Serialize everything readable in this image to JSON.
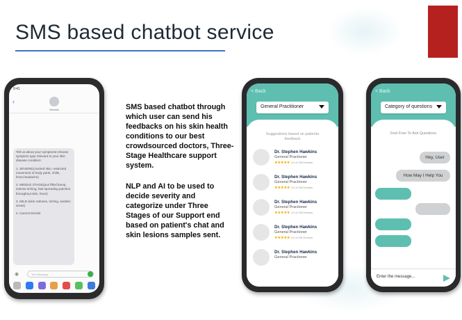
{
  "slide": {
    "title": "SMS based chatbot service",
    "paragraph1": "SMS based chatbot through which user can send his feedbacks on his skin health conditions to our best crowdsourced doctors, Three-Stage Healthcare support system.",
    "paragraph2": "NLP and AI to be used to decide severity and categorize under Three Stages of our Support end based on patient's chat and skin lesions samples sent."
  },
  "colors": {
    "accent": "#5ebfb0",
    "underline": "#3f6fc6",
    "red_block": "#b5211f"
  },
  "sms_phone": {
    "time": "9:41",
    "contact": "Generic",
    "message_lines": [
      "Tell us about your symptoms:Choose symptom type relevant to your skin disease condition:",
      "1. SEVERE(cracked skin, restricted movement of body parts, chills, fever,headache)",
      "2. MIDDLE STAGE(pus filled bump, intense itching, fast spreading patches throughout skin, fever)",
      "3. MILD-(skin redness, itching, swollen areas)",
      "4. Cannot Decide"
    ],
    "input_placeholder": "Text Message",
    "icons": [
      "camera-icon",
      "app-store-icon",
      "send-icon"
    ]
  },
  "doctor_phone": {
    "back_label": "< Back",
    "dropdown_value": "General Practitioner",
    "suggestions_label": "Suggestions based on patients feedback",
    "doctors": [
      {
        "name": "Dr. Stephen Hawkins",
        "specialty": "General Practioner",
        "stars": "★★★★★",
        "rating": "5.0 of 238 Reviews"
      },
      {
        "name": "Dr. Stephen Hawkins",
        "specialty": "General Practioner",
        "stars": "★★★★★",
        "rating": "5.0 of 238 Reviews"
      },
      {
        "name": "Dr. Stephen Hawkins",
        "specialty": "General Practioner",
        "stars": "★★★★★",
        "rating": "5.0 of 238 Reviews"
      },
      {
        "name": "Dr. Stephen Hawkins",
        "specialty": "General Practioner",
        "stars": "★★★★★",
        "rating": "5.0 of 238 Reviews"
      },
      {
        "name": "Dr. Stephen Hawkins",
        "specialty": "General Practioner",
        "stars": "",
        "rating": ""
      }
    ]
  },
  "chat_phone": {
    "back_label": "< Back",
    "dropdown_value": "Category of questions",
    "feel_free": "Feel Free To Ask Questions",
    "messages": [
      {
        "side": "right",
        "text": "Hey, User"
      },
      {
        "side": "right",
        "text": "How May I Help You"
      }
    ],
    "input_placeholder": "Enter the message..."
  }
}
